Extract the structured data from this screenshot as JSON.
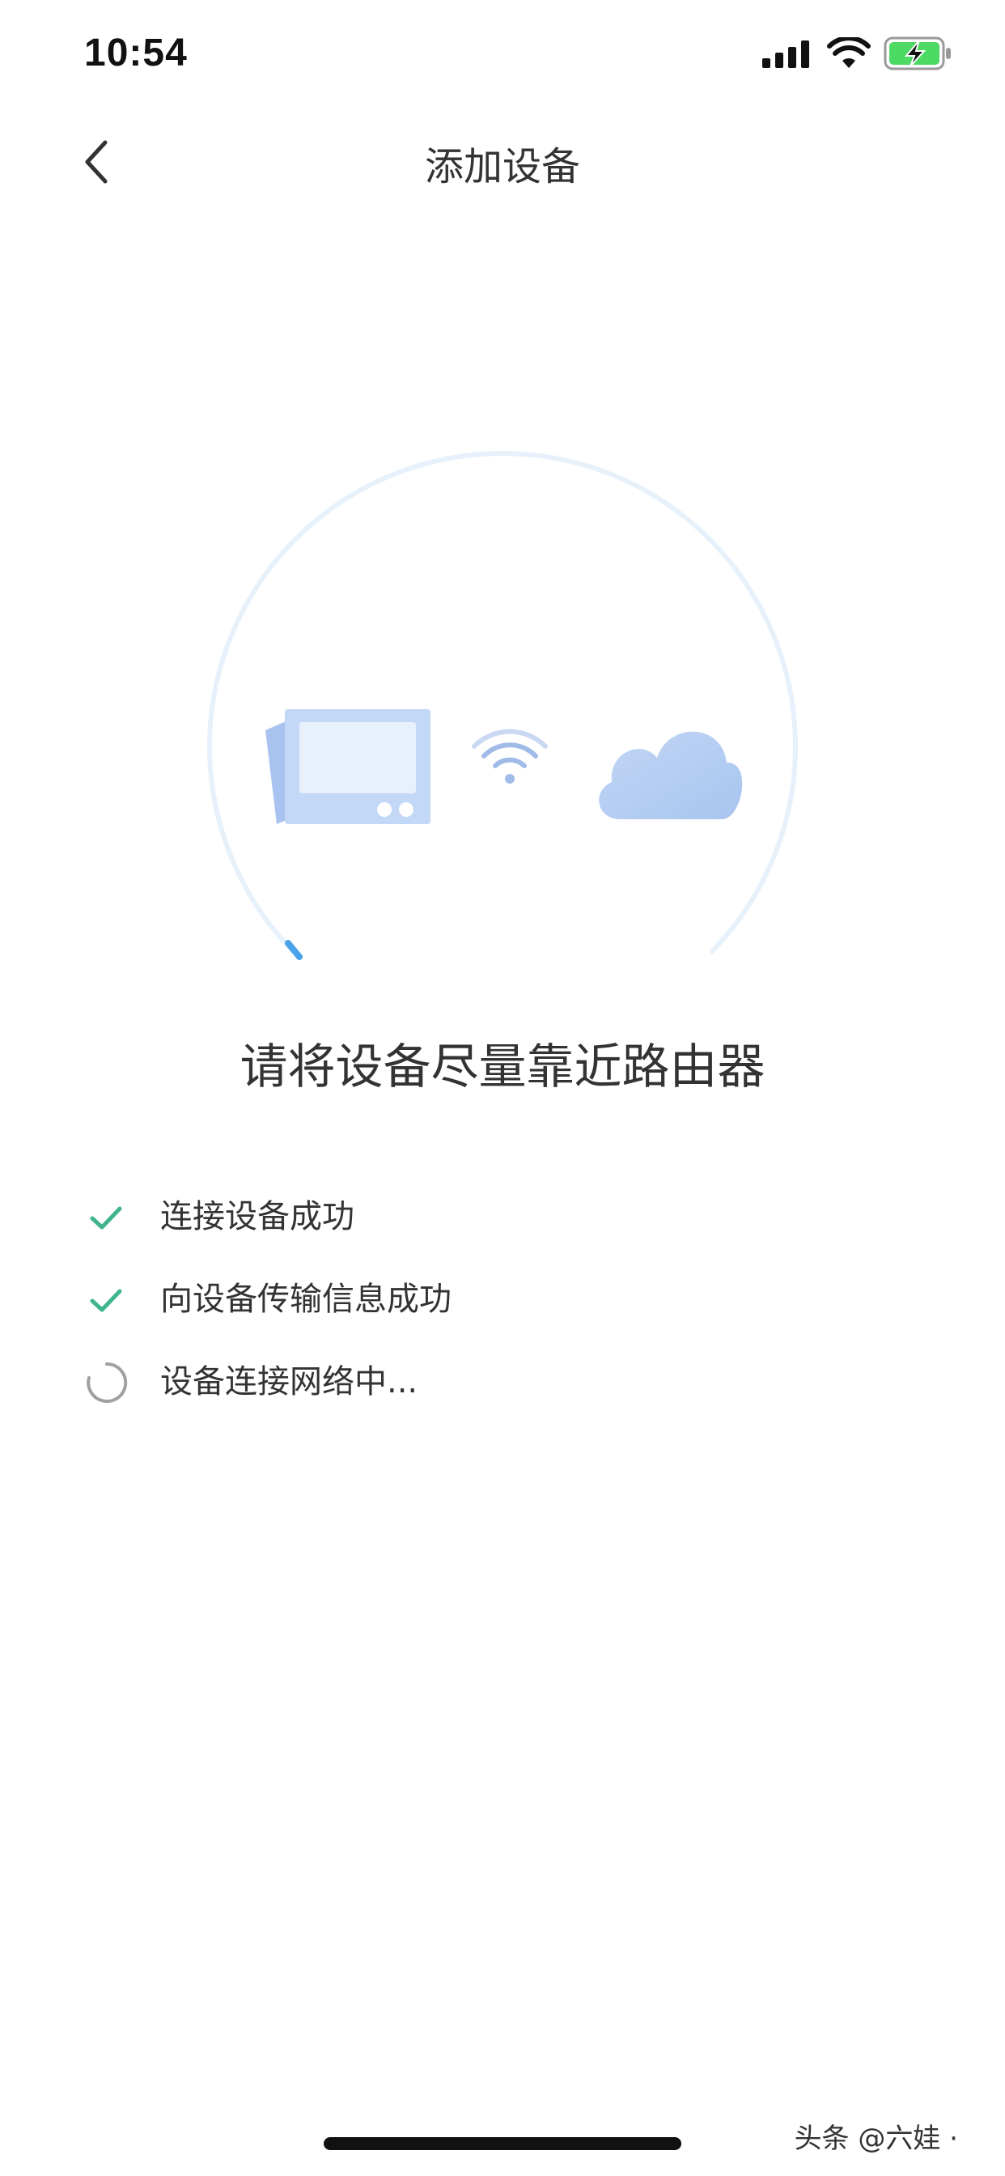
{
  "status_bar": {
    "time": "10:54",
    "icons": [
      "signal-icon",
      "wifi-icon",
      "battery-charging-icon"
    ],
    "battery_color": "#4cd964"
  },
  "nav": {
    "back_icon": "chevron-left-icon",
    "title": "添加设备"
  },
  "illustration": {
    "device_icon": "smart-display-icon",
    "wifi_icon": "wifi-icon",
    "cloud_icon": "cloud-icon",
    "ring_color": "#e6f1fb",
    "progress_color": "#4aa3e8"
  },
  "tip": "请将设备尽量靠近路由器",
  "steps": [
    {
      "label": "连接设备成功",
      "status": "done",
      "icon": "check-icon"
    },
    {
      "label": "向设备传输信息成功",
      "status": "done",
      "icon": "check-icon"
    },
    {
      "label": "设备连接网络中...",
      "status": "loading",
      "icon": "loading-spinner-icon"
    }
  ],
  "colors": {
    "check": "#3fb58e",
    "spinner": "#a0a0a0"
  },
  "watermark": "头条 @六娃 ·"
}
